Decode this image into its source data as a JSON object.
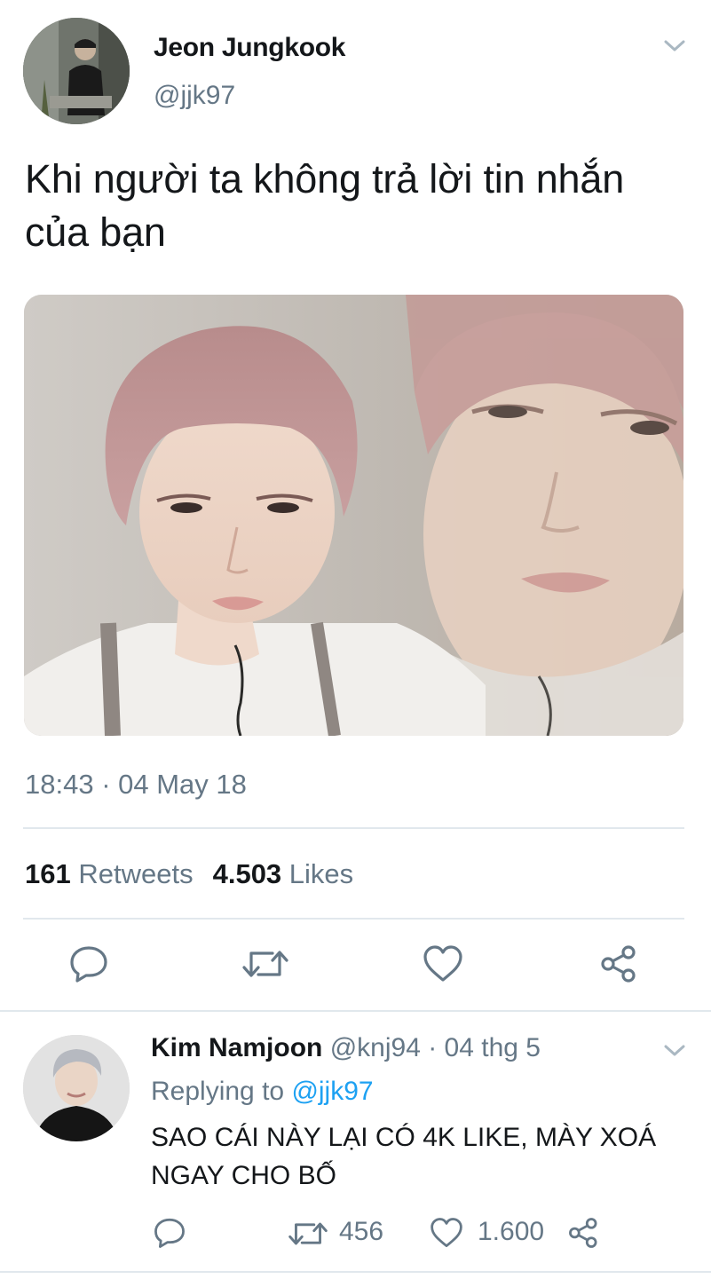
{
  "tweet": {
    "author": {
      "name": "Jeon Jungkook",
      "handle": "@jjk97"
    },
    "text": "Khi người ta không trả lời tin nhắn của bạn",
    "timestamp": "18:43 · 04 May 18",
    "stats": {
      "retweets_count": "161",
      "retweets_label": "Retweets",
      "likes_count": "4.503",
      "likes_label": "Likes"
    },
    "actions": [
      "reply-icon",
      "retweet-icon",
      "like-icon",
      "share-icon"
    ]
  },
  "reply": {
    "author_name": "Kim Namjoon",
    "meta": "@knj94 · 04 thg 5",
    "replying_prefix": "Replying to",
    "replying_mention": "@jjk97",
    "text": "SAO CÁI NÀY LẠI CÓ 4K LIKE, MÀY XOÁ NGAY CHO BỐ",
    "retweets": "456",
    "likes": "1.600"
  },
  "colors": {
    "text_primary": "#14171a",
    "text_secondary": "#657786",
    "link": "#1da1f2",
    "divider": "#e1e8ed"
  }
}
